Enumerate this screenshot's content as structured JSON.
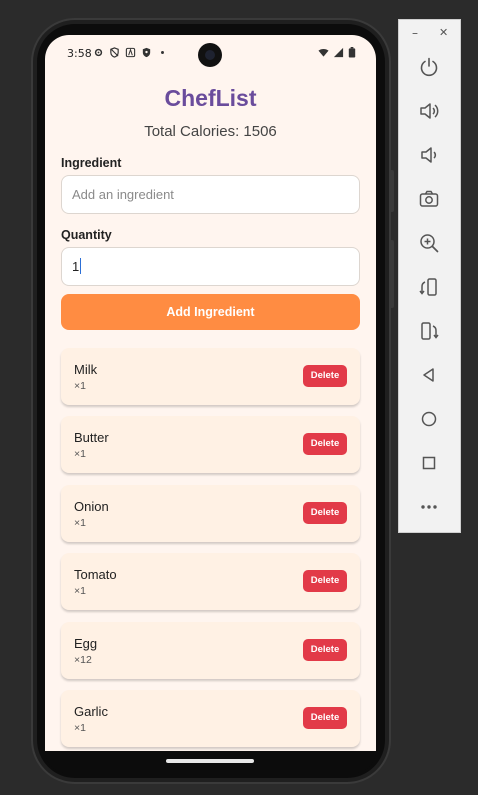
{
  "toolbar": {
    "minimize_label": "–",
    "close_label": "✕",
    "icons": [
      "power-icon",
      "volume-up-icon",
      "volume-down-icon",
      "camera-icon",
      "zoom-in-icon",
      "rotate-left-icon",
      "rotate-right-icon",
      "back-icon",
      "home-icon",
      "overview-icon",
      "more-icon"
    ]
  },
  "status_bar": {
    "time": "3:58"
  },
  "app": {
    "title": "ChefList",
    "total_calories": "Total Calories: 1506",
    "ingredient_label": "Ingredient",
    "ingredient_placeholder": "Add an ingredient",
    "quantity_label": "Quantity",
    "quantity_value": "1",
    "add_button_label": "Add Ingredient",
    "delete_label": "Delete",
    "items": [
      {
        "name": "Milk",
        "qty": "×1"
      },
      {
        "name": "Butter",
        "qty": "×1"
      },
      {
        "name": "Onion",
        "qty": "×1"
      },
      {
        "name": "Tomato",
        "qty": "×1"
      },
      {
        "name": "Egg",
        "qty": "×12"
      },
      {
        "name": "Garlic",
        "qty": "×1"
      }
    ]
  },
  "colors": {
    "title": "#6a4c9c",
    "accent_button": "#ff8c42",
    "delete_button": "#e23a48",
    "card_background": "#fff1e4",
    "screen_background": "#fff5ef"
  }
}
